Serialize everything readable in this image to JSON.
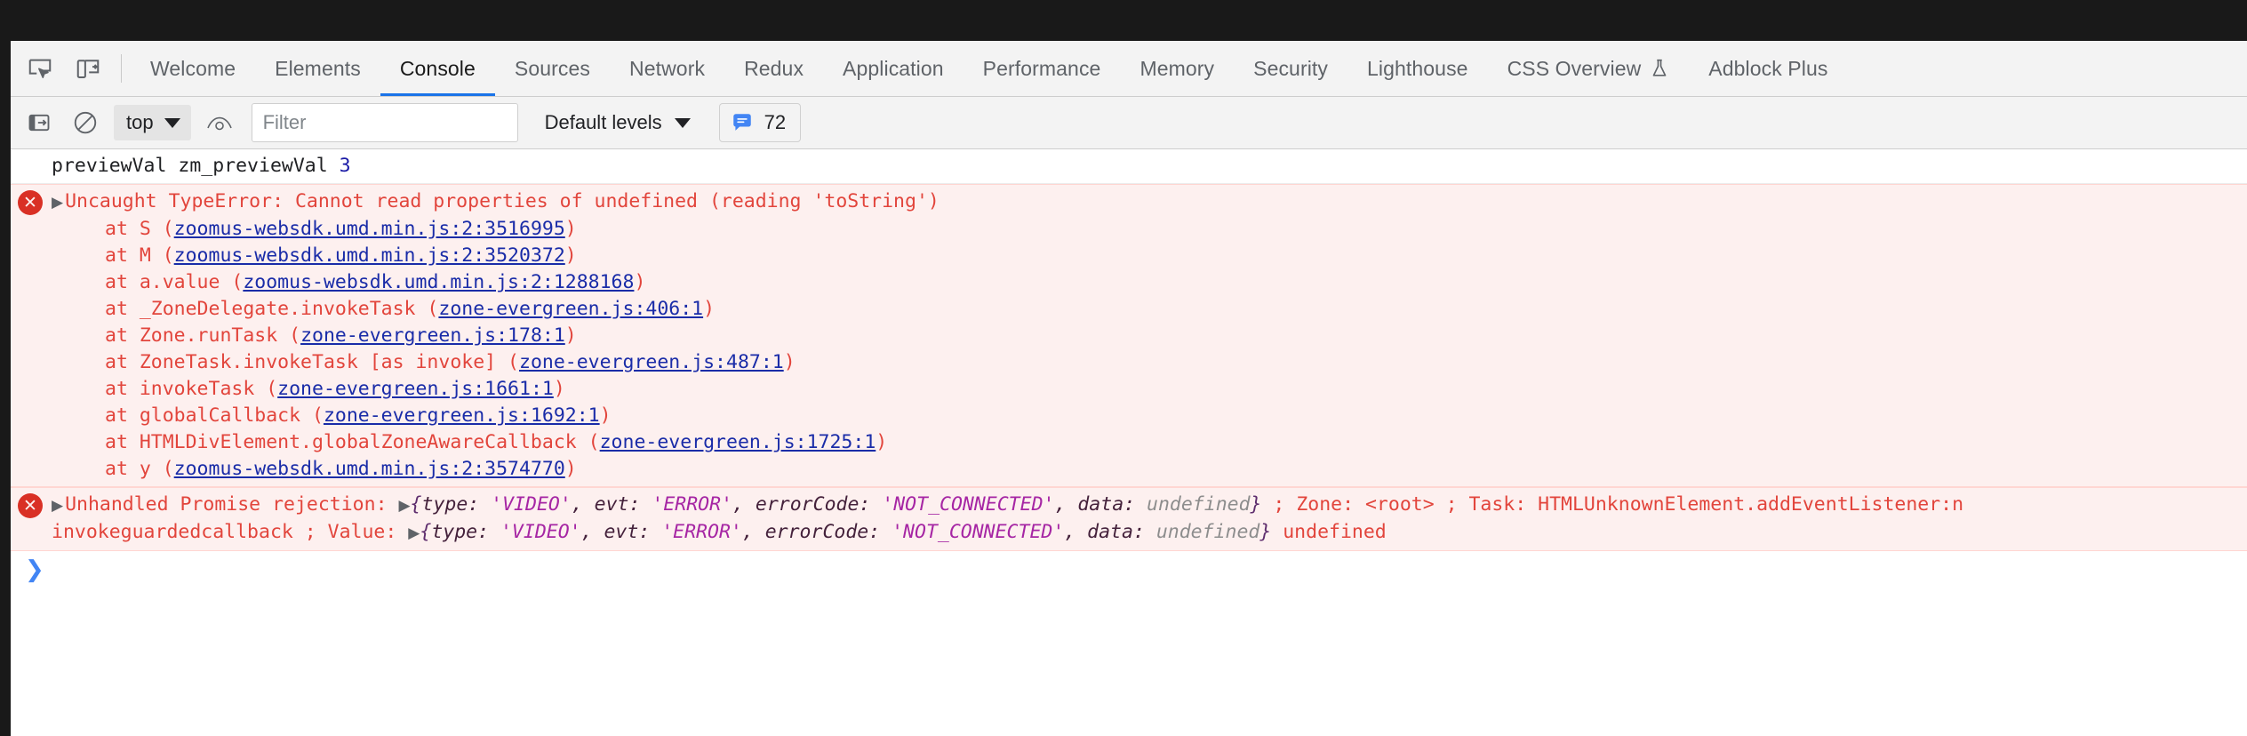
{
  "window": {
    "top_strip_color": "#191919"
  },
  "tabbar": {
    "icons": [
      {
        "name": "inspect-element-icon",
        "label": "Inspect element"
      },
      {
        "name": "device-toolbar-icon",
        "label": "Toggle device toolbar"
      }
    ],
    "tabs": [
      {
        "label": "Welcome",
        "selected": false
      },
      {
        "label": "Elements",
        "selected": false
      },
      {
        "label": "Console",
        "selected": true
      },
      {
        "label": "Sources",
        "selected": false
      },
      {
        "label": "Network",
        "selected": false
      },
      {
        "label": "Redux",
        "selected": false
      },
      {
        "label": "Application",
        "selected": false
      },
      {
        "label": "Performance",
        "selected": false
      },
      {
        "label": "Memory",
        "selected": false
      },
      {
        "label": "Security",
        "selected": false
      },
      {
        "label": "Lighthouse",
        "selected": false
      },
      {
        "label": "CSS Overview",
        "selected": false,
        "experimental": true
      },
      {
        "label": "Adblock Plus",
        "selected": false
      }
    ],
    "selected_tab": "Console",
    "selected_underline_color": "#1a73e8"
  },
  "console_toolbar": {
    "sidebar_toggle_name": "console-sidebar-toggle",
    "clear_console_name": "clear-console-icon",
    "context_value": "top",
    "live_expression_name": "create-live-expression-icon",
    "filter_placeholder": "Filter",
    "filter_value": "",
    "levels_value": "Default levels",
    "message_count": "72",
    "badge_color": "#4285f4"
  },
  "console": {
    "messages": [
      {
        "type": "log",
        "text": "previewVal zm_previewVal ",
        "value": "3"
      },
      {
        "type": "error",
        "title": "Uncaught TypeError: Cannot read properties of undefined (reading 'toString')",
        "stack": [
          {
            "prefix": "at S (",
            "link": "zoomus-websdk.umd.min.js:2:3516995",
            "suffix": ")"
          },
          {
            "prefix": "at M (",
            "link": "zoomus-websdk.umd.min.js:2:3520372",
            "suffix": ")"
          },
          {
            "prefix": "at a.value (",
            "link": "zoomus-websdk.umd.min.js:2:1288168",
            "suffix": ")"
          },
          {
            "prefix": "at _ZoneDelegate.invokeTask (",
            "link": "zone-evergreen.js:406:1",
            "suffix": ")"
          },
          {
            "prefix": "at Zone.runTask (",
            "link": "zone-evergreen.js:178:1",
            "suffix": ")"
          },
          {
            "prefix": "at ZoneTask.invokeTask [as invoke] (",
            "link": "zone-evergreen.js:487:1",
            "suffix": ")"
          },
          {
            "prefix": "at invokeTask (",
            "link": "zone-evergreen.js:1661:1",
            "suffix": ")"
          },
          {
            "prefix": "at globalCallback (",
            "link": "zone-evergreen.js:1692:1",
            "suffix": ")"
          },
          {
            "prefix": "at HTMLDivElement.globalZoneAwareCallback (",
            "link": "zone-evergreen.js:1725:1",
            "suffix": ")"
          },
          {
            "prefix": "at y (",
            "link": "zoomus-websdk.umd.min.js:2:3574770",
            "suffix": ")"
          }
        ]
      },
      {
        "type": "error",
        "title": "Unhandled Promise rejection: ",
        "object_open": "{",
        "object_parts": [
          {
            "key": "type: ",
            "str": "'VIDEO'",
            "sep": ", "
          },
          {
            "key": "evt: ",
            "str": "'ERROR'",
            "sep": ", "
          },
          {
            "key": "errorCode: ",
            "str": "'NOT_CONNECTED'",
            "sep": ", "
          },
          {
            "key": "data: ",
            "undef": "undefined",
            "sep": ""
          }
        ],
        "object_close": "}",
        "tail_line1": " ; Zone: <root> ; Task: HTMLUnknownElement.addEventListener:n",
        "line2_prefix": "invokeguardedcallback ; Value: ",
        "line2_tail": " undefined"
      }
    ],
    "prompt_symbol": "❯"
  }
}
